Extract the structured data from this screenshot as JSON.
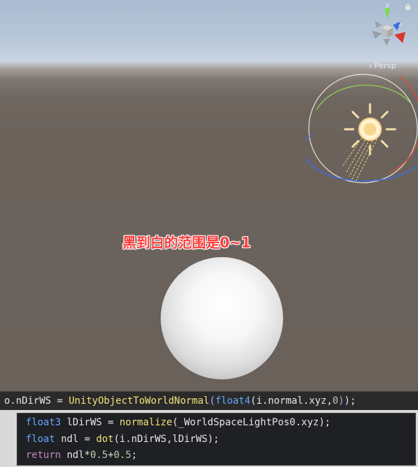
{
  "scene_view": {
    "camera_mode_label": "‹ Persp",
    "gizmo_axes": {
      "y": "y",
      "z": "z"
    },
    "annotation": "黑到白的范围是0~1"
  },
  "code": {
    "main_line": [
      {
        "t": "o.nDirWS = ",
        "c": "plain"
      },
      {
        "t": "UnityObjectToWorldNormal",
        "c": "fn"
      },
      {
        "t": "(",
        "c": "pp"
      },
      {
        "t": "float4",
        "c": "kw"
      },
      {
        "t": "(i.normal.xyz,",
        "c": "plain"
      },
      {
        "t": "0",
        "c": "num"
      },
      {
        "t": ")",
        "c": "pp"
      },
      {
        "t": ");",
        "c": "plain"
      }
    ],
    "block_lines": [
      [
        {
          "t": "float3",
          "c": "kw"
        },
        {
          "t": " lDirWS = ",
          "c": "plain"
        },
        {
          "t": "normalize",
          "c": "fn"
        },
        {
          "t": "(_WorldSpaceLightPos0.xyz);",
          "c": "plain"
        }
      ],
      [
        {
          "t": "float",
          "c": "kw"
        },
        {
          "t": " ndl = ",
          "c": "plain"
        },
        {
          "t": "dot",
          "c": "fn"
        },
        {
          "t": "(i.nDirWS,lDirWS);",
          "c": "plain"
        }
      ],
      [
        {
          "t": "return",
          "c": "kw2"
        },
        {
          "t": " ndl*",
          "c": "plain"
        },
        {
          "t": "0.5",
          "c": "num"
        },
        {
          "t": "+",
          "c": "plain"
        },
        {
          "t": "0.5",
          "c": "num"
        },
        {
          "t": ";",
          "c": "plain"
        }
      ]
    ]
  },
  "colors": {
    "annotation": "#ff3b3b",
    "keyword": "#64a6ff",
    "function": "#f0e27a",
    "number": "#b5cea8"
  }
}
